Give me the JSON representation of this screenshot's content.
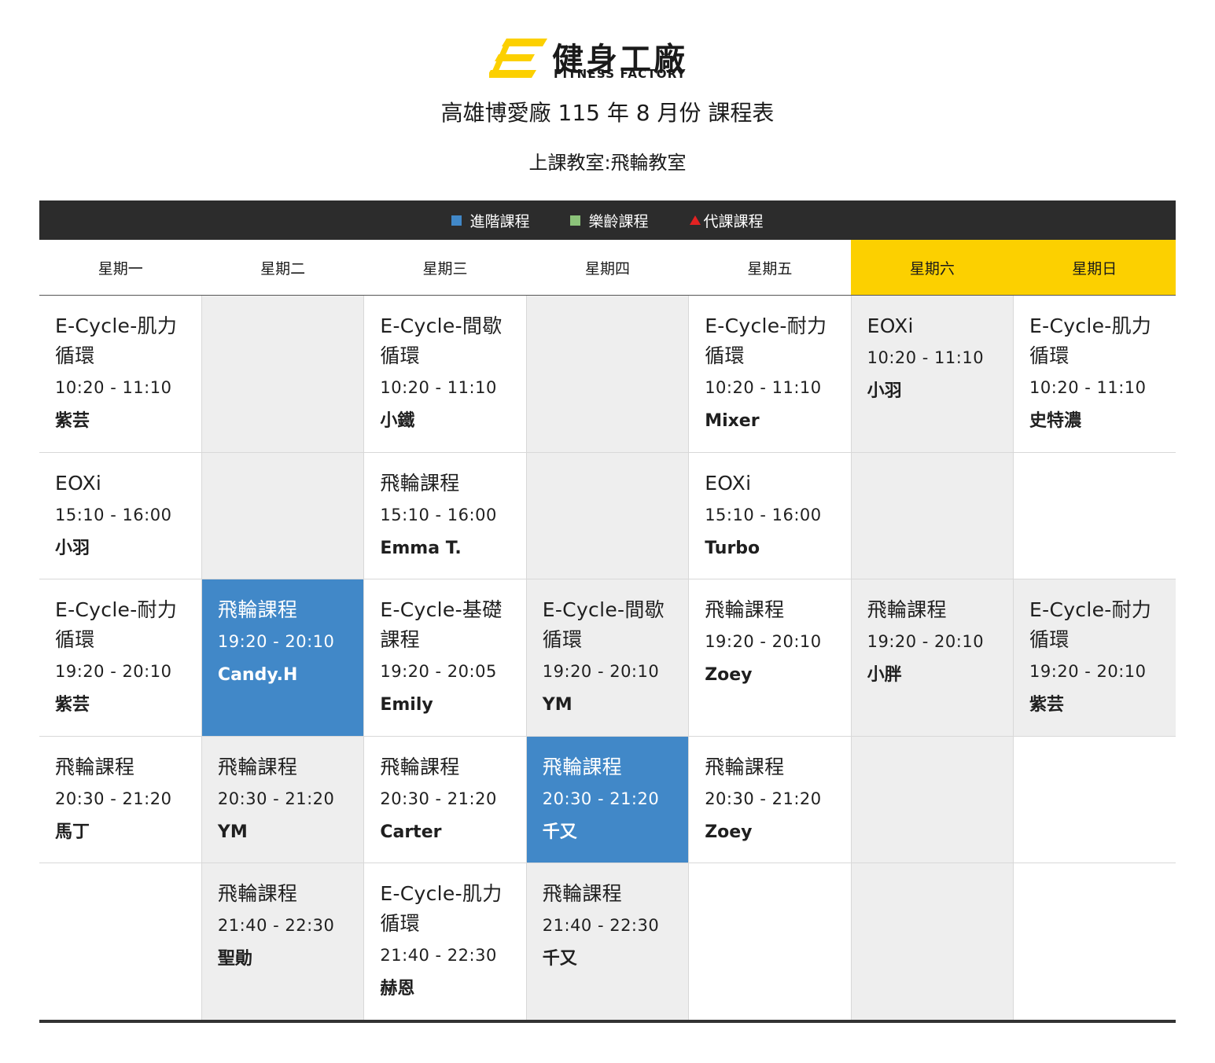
{
  "brand": {
    "name_cn": "健身工廠",
    "name_en": "FITNESS FACTORY",
    "colors": {
      "yellow": "#fcd000",
      "dark": "#2c2c2c"
    }
  },
  "title": "高雄博愛廠 115 年 8 月份 課程表",
  "subtitle": "上課教室:飛輪教室",
  "legend": [
    {
      "label": "進階課程",
      "color": "#4188c8",
      "marker": "square"
    },
    {
      "label": "樂齡課程",
      "color": "#8cc37a",
      "marker": "square"
    },
    {
      "label": "代課課程",
      "color": "#e32222",
      "marker": "triangle"
    }
  ],
  "days": [
    "星期一",
    "星期二",
    "星期三",
    "星期四",
    "星期五",
    "星期六",
    "星期日"
  ],
  "colors": {
    "advanced": "#4188c8",
    "grey_cell": "#eeeeee",
    "weekend_header": "#fcd000"
  },
  "rows": [
    {
      "cells": [
        {
          "course": "E-Cycle-肌力循環",
          "time": "10:20 - 11:10",
          "coach": "紫芸",
          "style": "w"
        },
        {
          "style": "g"
        },
        {
          "course": "E-Cycle-間歇循環",
          "time": "10:20 - 11:10",
          "coach": "小鐵",
          "style": "w"
        },
        {
          "style": "g"
        },
        {
          "course": "E-Cycle-耐力循環",
          "time": "10:20 - 11:10",
          "coach": "Mixer",
          "style": "w"
        },
        {
          "course": "EOXi",
          "time": "10:20 - 11:10",
          "coach": "小羽",
          "style": "g"
        },
        {
          "course": "E-Cycle-肌力循環",
          "time": "10:20 - 11:10",
          "coach": "史特濃",
          "style": "w"
        }
      ]
    },
    {
      "cells": [
        {
          "course": "EOXi",
          "time": "15:10 - 16:00",
          "coach": "小羽",
          "style": "w"
        },
        {
          "style": "g"
        },
        {
          "course": "飛輪課程",
          "time": "15:10 - 16:00",
          "coach": "Emma T.",
          "style": "w"
        },
        {
          "style": "g"
        },
        {
          "course": "EOXi",
          "time": "15:10 - 16:00",
          "coach": "Turbo",
          "style": "w"
        },
        {
          "style": "g"
        },
        {
          "style": "w"
        }
      ]
    },
    {
      "cells": [
        {
          "course": "E-Cycle-耐力循環",
          "time": "19:20 - 20:10",
          "coach": "紫芸",
          "style": "w"
        },
        {
          "course": "飛輪課程",
          "time": "19:20 - 20:10",
          "coach": "Candy.H",
          "style": "b"
        },
        {
          "course": "E-Cycle-基礎課程",
          "time": "19:20 - 20:05",
          "coach": "Emily",
          "style": "w"
        },
        {
          "course": "E-Cycle-間歇循環",
          "time": "19:20 - 20:10",
          "coach": "YM",
          "style": "g"
        },
        {
          "course": "飛輪課程",
          "time": "19:20 - 20:10",
          "coach": "Zoey",
          "style": "w"
        },
        {
          "course": "飛輪課程",
          "time": "19:20 - 20:10",
          "coach": "小胖",
          "style": "g"
        },
        {
          "course": "E-Cycle-耐力循環",
          "time": "19:20 - 20:10",
          "coach": "紫芸",
          "style": "g"
        }
      ]
    },
    {
      "cells": [
        {
          "course": "飛輪課程",
          "time": "20:30 - 21:20",
          "coach": "馬丁",
          "style": "w"
        },
        {
          "course": "飛輪課程",
          "time": "20:30 - 21:20",
          "coach": "YM",
          "style": "g"
        },
        {
          "course": "飛輪課程",
          "time": "20:30 - 21:20",
          "coach": "Carter",
          "style": "w"
        },
        {
          "course": "飛輪課程",
          "time": "20:30 - 21:20",
          "coach": "千又",
          "style": "b"
        },
        {
          "course": "飛輪課程",
          "time": "20:30 - 21:20",
          "coach": "Zoey",
          "style": "w"
        },
        {
          "style": "g"
        },
        {
          "style": "w"
        }
      ]
    },
    {
      "cells": [
        {
          "style": "w"
        },
        {
          "course": "飛輪課程",
          "time": "21:40 - 22:30",
          "coach": "聖勛",
          "style": "g"
        },
        {
          "course": "E-Cycle-肌力循環",
          "time": "21:40 - 22:30",
          "coach": "赫恩",
          "style": "w"
        },
        {
          "course": "飛輪課程",
          "time": "21:40 - 22:30",
          "coach": "千又",
          "style": "g"
        },
        {
          "style": "w"
        },
        {
          "style": "g"
        },
        {
          "style": "w"
        }
      ]
    }
  ]
}
